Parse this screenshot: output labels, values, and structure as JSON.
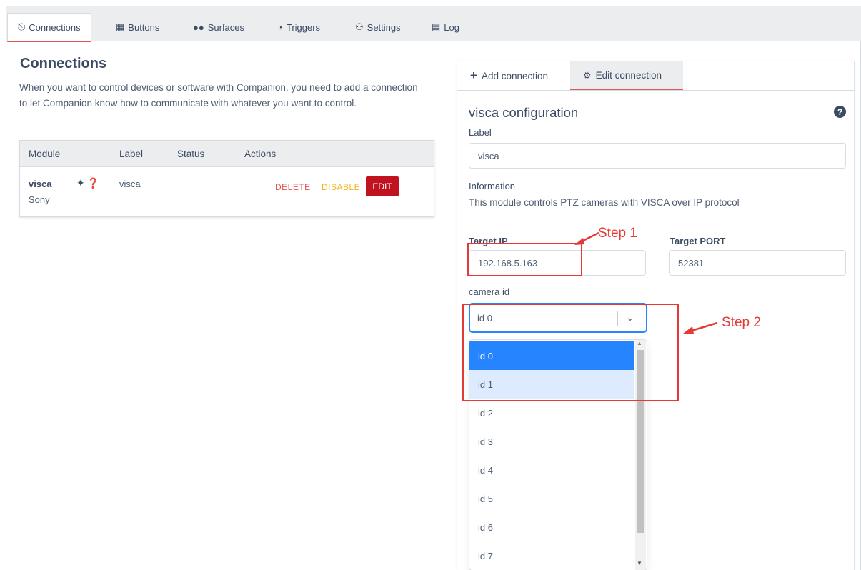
{
  "nav": {
    "tabs": [
      {
        "label": "Connections",
        "icon": "plug-icon"
      },
      {
        "label": "Buttons",
        "icon": "calendar-icon"
      },
      {
        "label": "Surfaces",
        "icon": "gamepad-icon"
      },
      {
        "label": "Triggers",
        "icon": "clock-icon"
      },
      {
        "label": "Settings",
        "icon": "users-cog-icon"
      },
      {
        "label": "Log",
        "icon": "clipboard-icon"
      }
    ]
  },
  "connections": {
    "title": "Connections",
    "description": "When you want to control devices or software with Companion, you need to add a connection to let Companion know how to communicate with whatever you want to control.",
    "columns": [
      "Module",
      "Label",
      "Status",
      "Actions"
    ],
    "rows": [
      {
        "module": "visca",
        "vendor": "Sony",
        "label": "visca",
        "status": "",
        "delete": "DELETE",
        "disable": "DISABLE",
        "edit": "EDIT"
      }
    ]
  },
  "panel": {
    "tabs": {
      "add": "Add connection",
      "edit": "Edit connection"
    },
    "title": "visca configuration",
    "label_title": "Label",
    "label_value": "visca",
    "info_title": "Information",
    "info_text": "This module controls PTZ cameras with VISCA over IP protocol",
    "target_ip_label": "Target IP",
    "target_ip": "192.168.5.163",
    "target_port_label": "Target PORT",
    "target_port": "52381",
    "camera_id_label": "camera id",
    "camera_id_value": "id 0",
    "options": [
      "id 0",
      "id 1",
      "id 2",
      "id 3",
      "id 4",
      "id 5",
      "id 6",
      "id 7"
    ]
  },
  "annotations": {
    "step1": "Step 1",
    "step2": "Step 2",
    "color": "#e53935"
  },
  "colors": {
    "accent": "#e55353",
    "edit_button": "#c0121f",
    "disable": "#f9b115",
    "select_focus": "#2684ff"
  }
}
